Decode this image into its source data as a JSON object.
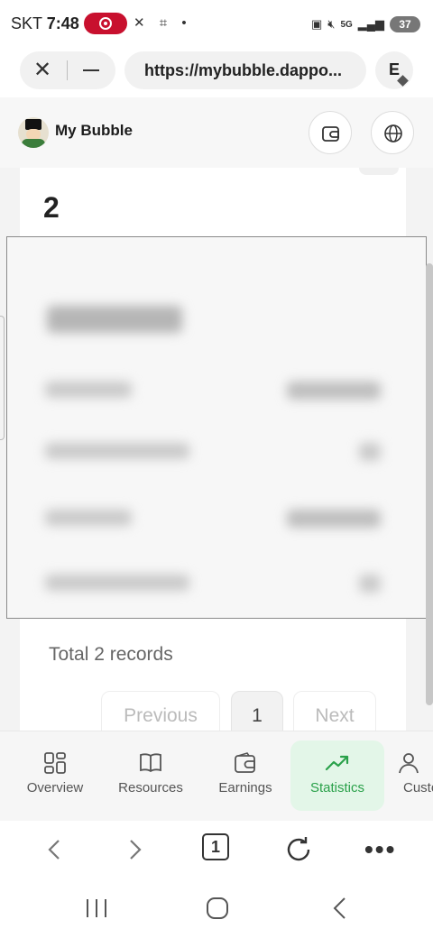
{
  "status_bar": {
    "carrier": "SKT",
    "time": "7:48",
    "network": "5G",
    "battery": "37"
  },
  "browser": {
    "url": "https://mybubble.dappo...",
    "extension_letter": "E"
  },
  "app": {
    "name": "My Bubble"
  },
  "main": {
    "count": "2",
    "total_records": "Total 2 records",
    "pagination": {
      "previous": "Previous",
      "current_page": "1",
      "next": "Next"
    }
  },
  "bottom_nav": {
    "items": [
      {
        "label": "Overview",
        "icon": "grid-icon"
      },
      {
        "label": "Resources",
        "icon": "book-icon"
      },
      {
        "label": "Earnings",
        "icon": "wallet-icon"
      },
      {
        "label": "Statistics",
        "icon": "trending-up-icon",
        "active": true
      },
      {
        "label": "Custo",
        "icon": "user-icon"
      }
    ]
  },
  "browser_toolbar": {
    "tab_count": "1"
  },
  "colors": {
    "accent": "#2aa14a",
    "active_bg": "#e3f6e8",
    "record_red": "#c8102e"
  }
}
